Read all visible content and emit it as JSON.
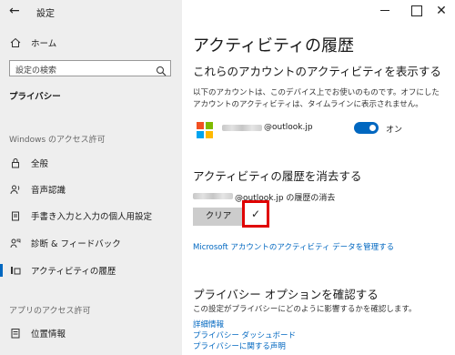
{
  "window": {
    "title": "設定",
    "back_glyph": "←",
    "close_glyph": "✕"
  },
  "sidebar": {
    "home_label": "ホーム",
    "search_placeholder": "設定の検索",
    "section_title": "プライバシー",
    "group_windows": "Windows のアクセス許可",
    "items": [
      {
        "label": "全般",
        "icon": "lock-icon"
      },
      {
        "label": "音声認識",
        "icon": "speech-icon"
      },
      {
        "label": "手書き入力と入力の個人用設定",
        "icon": "clipboard-icon"
      },
      {
        "label": "診断 & フィードバック",
        "icon": "feedback-icon"
      },
      {
        "label": "アクティビティの履歴",
        "icon": "activity-icon",
        "active": true
      }
    ],
    "group_app": "アプリのアクセス許可",
    "app_items": [
      {
        "label": "位置情報",
        "icon": "location-icon"
      }
    ]
  },
  "main": {
    "title": "アクティビティの履歴",
    "show_section": {
      "heading": "これらのアカウントのアクティビティを表示する",
      "description": "以下のアカウントは、このデバイス上でお使いのものです。オフにしたアカウントのアクティビティは、タイムラインに表示されません。",
      "account_domain": "@outlook.jp",
      "toggle_label": "オン"
    },
    "clear_section": {
      "heading": "アクティビティの履歴を消去する",
      "account_line": "@outlook.jp の履歴の消去",
      "clear_button": "クリア",
      "check_glyph": "✓"
    },
    "manage_link": "Microsoft アカウントのアクティビティ データを管理する",
    "privacy_section": {
      "heading": "プライバシー オプションを確認する",
      "description": "この設定がプライバシーにどのように影響するかを確認します。",
      "links": [
        "詳細情報",
        "プライバシー ダッシュボード",
        "プライバシーに関する声明"
      ]
    }
  },
  "colors": {
    "accent": "#0067c0",
    "highlight_border": "#e00000",
    "sidebar_bg": "#eeeeee",
    "ms_red": "#f25022",
    "ms_green": "#7fba00",
    "ms_blue": "#00a4ef",
    "ms_yellow": "#ffb900"
  }
}
